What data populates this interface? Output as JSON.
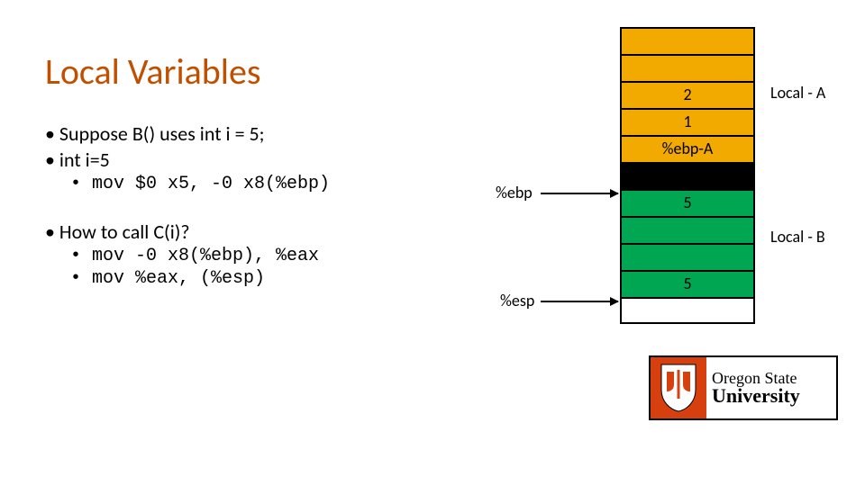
{
  "title": "Local Variables",
  "bullets": {
    "b1": "• Suppose B() uses int i = 5;",
    "b2": "• int i=5",
    "sub1": "• mov $0 x5, -0 x8(%ebp)",
    "b3": "• How to call C(i)?",
    "sub2": "• mov -0 x8(%ebp), %eax",
    "sub3": "• mov %eax, (%esp)"
  },
  "stack": {
    "cells": [
      "",
      "",
      "2",
      "1",
      "%ebp-A",
      "",
      "5",
      "",
      "",
      "5",
      ""
    ]
  },
  "labels": {
    "localA": "Local - A",
    "localB": "Local - B",
    "ebp": "%ebp",
    "esp": "%esp"
  },
  "logo": {
    "line1": "Oregon State",
    "line2": "University"
  }
}
